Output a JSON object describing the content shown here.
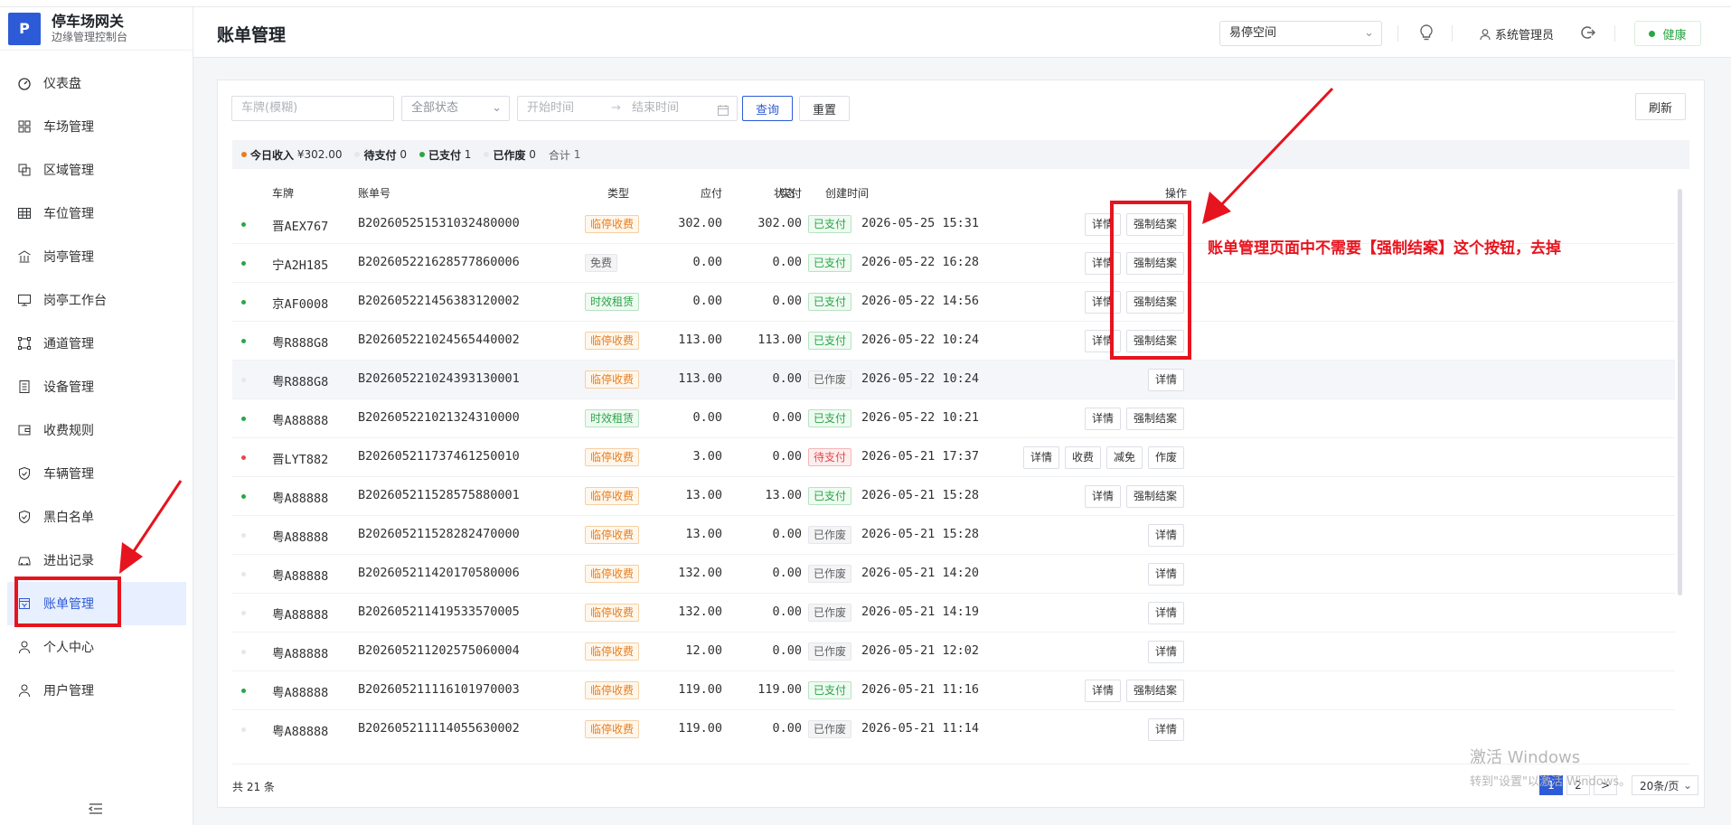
{
  "sidebar": {
    "logo": "P",
    "title": "停车场网关",
    "subtitle": "边缘管理控制台",
    "items": [
      {
        "label": "仪表盘",
        "icon": "dashboard-icon"
      },
      {
        "label": "车场管理",
        "icon": "grid-icon"
      },
      {
        "label": "区域管理",
        "icon": "area-icon"
      },
      {
        "label": "车位管理",
        "icon": "table-icon"
      },
      {
        "label": "岗亭管理",
        "icon": "building-icon"
      },
      {
        "label": "岗亭工作台",
        "icon": "monitor-icon"
      },
      {
        "label": "通道管理",
        "icon": "channel-icon"
      },
      {
        "label": "设备管理",
        "icon": "device-icon"
      },
      {
        "label": "收费规则",
        "icon": "wallet-icon"
      },
      {
        "label": "车辆管理",
        "icon": "shield-icon"
      },
      {
        "label": "黑白名单",
        "icon": "shield-check-icon"
      },
      {
        "label": "进出记录",
        "icon": "car-icon"
      },
      {
        "label": "账单管理",
        "icon": "bill-icon"
      },
      {
        "label": "个人中心",
        "icon": "user-icon"
      },
      {
        "label": "用户管理",
        "icon": "users-icon"
      }
    ],
    "active_index": 12
  },
  "header": {
    "title": "账单管理",
    "space_select": "易停空间",
    "user": "系统管理员",
    "health": "健康"
  },
  "filters": {
    "plate_placeholder": "车牌(模糊)",
    "status_value": "全部状态",
    "start_placeholder": "开始时间",
    "end_placeholder": "结束时间",
    "search_label": "查询",
    "reset_label": "重置",
    "refresh_label": "刷新"
  },
  "summary": {
    "income_label": "今日收入",
    "income_value": "¥302.00",
    "unpaid_label": "待支付",
    "unpaid_value": "0",
    "paid_label": "已支付",
    "paid_value": "1",
    "void_label": "已作废",
    "void_value": "0",
    "total_label": "合计",
    "total_value": "1"
  },
  "table": {
    "columns": [
      "车牌",
      "账单号",
      "类型",
      "应付",
      "实付",
      "状态",
      "创建时间",
      "操作"
    ],
    "rows": [
      {
        "plate": "晋AEX767",
        "bill_no": "B202605251531032480000",
        "type": "临停收费",
        "due": "302.00",
        "paid": "302.00",
        "status": "已支付",
        "time": "2026-05-25 15:31",
        "ops": [
          "详情",
          "强制结案"
        ]
      },
      {
        "plate": "宁A2H185",
        "bill_no": "B202605221628577860006",
        "type": "免费",
        "due": "0.00",
        "paid": "0.00",
        "status": "已支付",
        "time": "2026-05-22 16:28",
        "ops": [
          "详情",
          "强制结案"
        ]
      },
      {
        "plate": "京AF0008",
        "bill_no": "B202605221456383120002",
        "type": "时效租赁",
        "due": "0.00",
        "paid": "0.00",
        "status": "已支付",
        "time": "2026-05-22 14:56",
        "ops": [
          "详情",
          "强制结案"
        ]
      },
      {
        "plate": "粤R888G8",
        "bill_no": "B202605221024565440002",
        "type": "临停收费",
        "due": "113.00",
        "paid": "113.00",
        "status": "已支付",
        "time": "2026-05-22 10:24",
        "ops": [
          "详情",
          "强制结案"
        ]
      },
      {
        "plate": "粤R888G8",
        "bill_no": "B202605221024393130001",
        "type": "临停收费",
        "due": "113.00",
        "paid": "0.00",
        "status": "已作废",
        "time": "2026-05-22 10:24",
        "ops": [
          "详情"
        ]
      },
      {
        "plate": "粤A88888",
        "bill_no": "B202605221021324310000",
        "type": "时效租赁",
        "due": "0.00",
        "paid": "0.00",
        "status": "已支付",
        "time": "2026-05-22 10:21",
        "ops": [
          "详情",
          "强制结案"
        ]
      },
      {
        "plate": "晋LYT882",
        "bill_no": "B202605211737461250010",
        "type": "临停收费",
        "due": "3.00",
        "paid": "0.00",
        "status": "待支付",
        "time": "2026-05-21 17:37",
        "ops": [
          "详情",
          "收费",
          "减免",
          "作废"
        ]
      },
      {
        "plate": "粤A88888",
        "bill_no": "B202605211528575880001",
        "type": "临停收费",
        "due": "13.00",
        "paid": "13.00",
        "status": "已支付",
        "time": "2026-05-21 15:28",
        "ops": [
          "详情",
          "强制结案"
        ]
      },
      {
        "plate": "粤A88888",
        "bill_no": "B202605211528282470000",
        "type": "临停收费",
        "due": "13.00",
        "paid": "0.00",
        "status": "已作废",
        "time": "2026-05-21 15:28",
        "ops": [
          "详情"
        ]
      },
      {
        "plate": "粤A88888",
        "bill_no": "B202605211420170580006",
        "type": "临停收费",
        "due": "132.00",
        "paid": "0.00",
        "status": "已作废",
        "time": "2026-05-21 14:20",
        "ops": [
          "详情"
        ]
      },
      {
        "plate": "粤A88888",
        "bill_no": "B202605211419533570005",
        "type": "临停收费",
        "due": "132.00",
        "paid": "0.00",
        "status": "已作废",
        "time": "2026-05-21 14:19",
        "ops": [
          "详情"
        ]
      },
      {
        "plate": "粤A88888",
        "bill_no": "B202605211202575060004",
        "type": "临停收费",
        "due": "12.00",
        "paid": "0.00",
        "status": "已作废",
        "time": "2026-05-21 12:02",
        "ops": [
          "详情"
        ]
      },
      {
        "plate": "粤A88888",
        "bill_no": "B202605211116101970003",
        "type": "临停收费",
        "due": "119.00",
        "paid": "119.00",
        "status": "已支付",
        "time": "2026-05-21 11:16",
        "ops": [
          "详情",
          "强制结案"
        ]
      },
      {
        "plate": "粤A88888",
        "bill_no": "B202605211114055630002",
        "type": "临停收费",
        "due": "119.00",
        "paid": "0.00",
        "status": "已作废",
        "time": "2026-05-21 11:14",
        "ops": [
          "详情"
        ]
      }
    ]
  },
  "footer": {
    "total": "共 21 条",
    "pages": [
      "1",
      "2"
    ],
    "next": ">",
    "page_size": "20条/页"
  },
  "watermark": {
    "line1": "激活 Windows",
    "line2": "转到\"设置\"以激活 Windows。"
  },
  "annotation": {
    "text": "账单管理页面中不需要【强制结案】这个按钮，去掉",
    "color": "#e6141e"
  },
  "colors": {
    "accent": "#2d5bd7",
    "paid": "#28a745",
    "unpaid": "#e5484d",
    "temp_fee": "#e67e22",
    "lease": "#28a745"
  }
}
